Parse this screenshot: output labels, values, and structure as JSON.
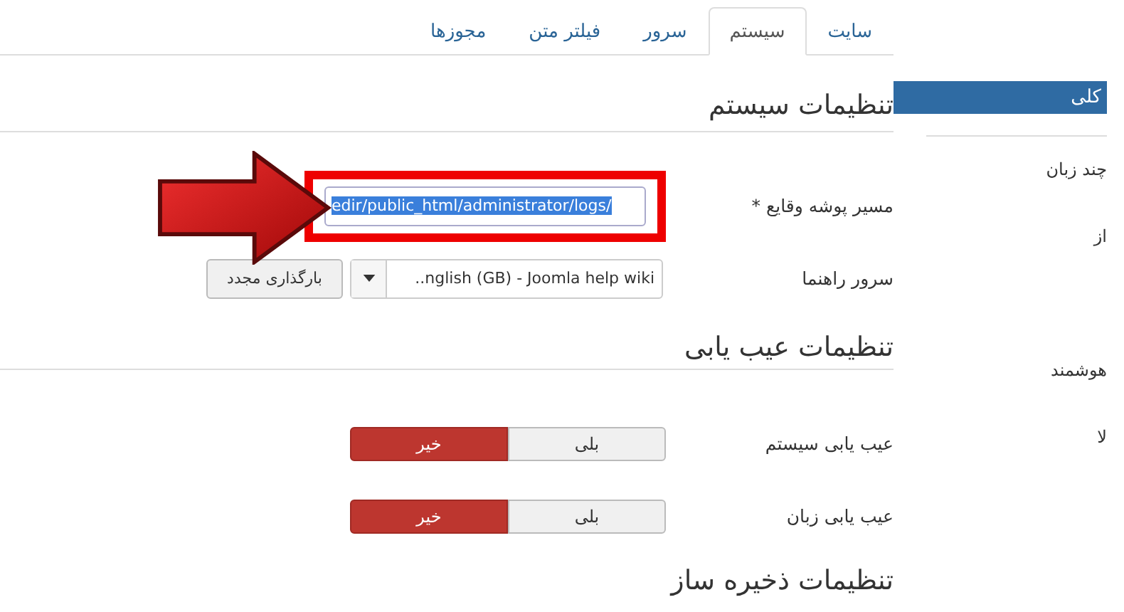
{
  "tabs": [
    {
      "label": "سایت",
      "selected": false
    },
    {
      "label": "سیستم",
      "selected": true
    },
    {
      "label": "سرور",
      "selected": false
    },
    {
      "label": "فیلتر متن",
      "selected": false
    },
    {
      "label": "مجوزها",
      "selected": false
    }
  ],
  "sections": [
    {
      "title": "تنظیمات سیستم",
      "fields": [
        {
          "kind": "text",
          "label": "مسیر پوشه وقایع *",
          "value": "edir/public_html/administrator/logs/",
          "highlighted": true
        },
        {
          "kind": "select",
          "label": "سرور راهنما",
          "value": "..nglish (GB) - Joomla help wiki",
          "button": "بارگذاری مجدد"
        }
      ]
    },
    {
      "title": "تنظیمات عیب یابی",
      "fields": [
        {
          "kind": "toggle",
          "label": "عیب یابی سیستم",
          "options": [
            {
              "label": "بلی",
              "selected": false
            },
            {
              "label": "خیر",
              "selected": true
            }
          ]
        },
        {
          "kind": "toggle",
          "label": "عیب یابی زبان",
          "options": [
            {
              "label": "بلی",
              "selected": false
            },
            {
              "label": "خیر",
              "selected": true
            }
          ]
        }
      ]
    },
    {
      "title": "تنظیمات ذخیره ساز"
    }
  ],
  "side_panel": {
    "header": "کلی",
    "labels": [
      "چند زبان",
      "از",
      "هوشمند",
      "لا"
    ]
  }
}
